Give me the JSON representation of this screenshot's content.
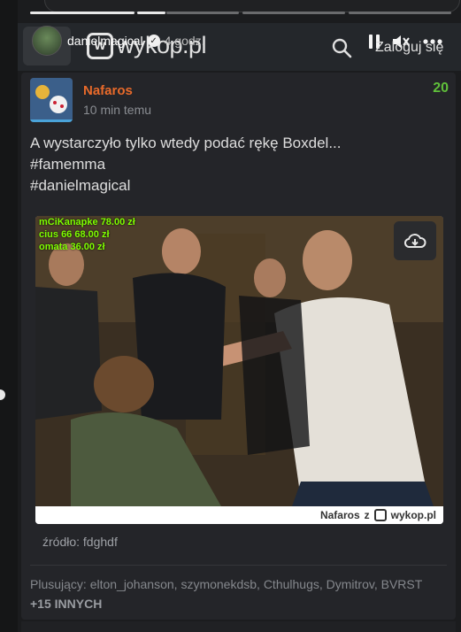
{
  "story": {
    "username": "danielmagical",
    "time": "4 godz."
  },
  "header": {
    "logo_text": "wykop.pl",
    "login_label": "Zaloguj się"
  },
  "post": {
    "author": "Nafaros",
    "time": "10 min temu",
    "votes": "20",
    "lines": [
      "A wystarczyło tylko wtedy podać rękę Boxdel...",
      "#famemma",
      "#danielmagical"
    ],
    "media": {
      "ticker": [
        "mCiKanapke 78.00 zł",
        "cius 66 68.00 zł",
        "omata 36.00 zł"
      ],
      "credit_author": "Nafaros",
      "credit_sep": "z",
      "credit_site": "wykop.pl"
    },
    "source": "źródło: fdghdf",
    "plus_list": "Plusujący: elton_johanson, szymonekdsb, Cthulhugs, Dymitrov, BVRST",
    "plus_more": "+15 INNYCH"
  },
  "colors": {
    "author": "#e86a2a",
    "votes": "#5fbf3a",
    "background": "#1b1c1e"
  }
}
